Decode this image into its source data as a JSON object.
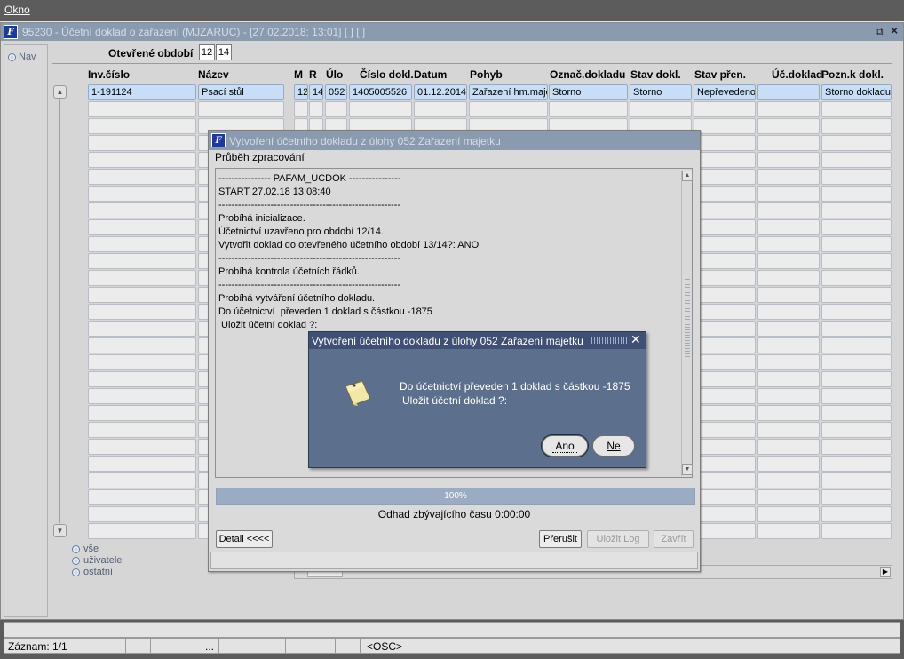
{
  "menu": {
    "okno": "Okno"
  },
  "window": {
    "title": "95230 - Účetní doklad o zařazení (MJZARUC) - [27.02.2018; 13:01]  [ ]  [ ]",
    "restore_icon": "restore-icon",
    "close_glyph": "×"
  },
  "nav": {
    "label": "Nav"
  },
  "period": {
    "label": "Otevřené období",
    "values": [
      "12",
      "14"
    ]
  },
  "table": {
    "headers": [
      "Inv.číslo",
      "Název",
      "M",
      "R",
      "Úlo",
      "Číslo dokl.",
      "Datum",
      "Pohyb",
      "Označ.dokladu",
      "Stav dokl.",
      "Stav přen.",
      "Úč.doklad",
      "Pozn.k dokl."
    ],
    "rows": [
      [
        "1-191124",
        "Psací stůl",
        "12",
        "14",
        "052",
        "1405005526",
        "01.12.2014",
        "Zařazení hm.maje",
        "Storno",
        "Storno",
        "Nepřevedeno",
        "",
        "Storno dokladu"
      ]
    ]
  },
  "filters": [
    "vše",
    "uživatele",
    "ostatní"
  ],
  "progress_dialog": {
    "title": "Vytvoření účetního dokladu z úlohy 052 Zařazení majetku",
    "section": "Průběh zpracování",
    "log": [
      "---------------- PAFAM_UCDOK ----------------",
      "START 27.02.18 13:08:40",
      "--------------------------------------------------------",
      "Probíhá inicializace.",
      "Účetnictví uzavřeno pro období 12/14.",
      "Vytvořit doklad do otevřeného účetního období 13/14?: ANO",
      "--------------------------------------------------------",
      "Probíhá kontrola účetních řádků.",
      "--------------------------------------------------------",
      "Probíhá vytváření účetního dokladu.",
      "Do účetnictví  převeden 1 doklad s částkou -1875",
      " Uložit účetní doklad ?:"
    ],
    "progress_value": 100,
    "progress_text": "100%",
    "eta": "Odhad zbývajícího času 0:00:00",
    "buttons": {
      "detail": "Detail <<<<",
      "prerusit": "Přerušit",
      "ulozit_log": "Uložit.Log",
      "zavrit": "Zavřít"
    }
  },
  "confirm_dialog": {
    "title": "Vytvoření účetního dokladu z úlohy 052 Zařazení majetku",
    "message_line1": "Do účetnictví  převeden 1 doklad s částkou -1875",
    "message_line2": "Uložit účetní doklad ?:",
    "icon": "note-icon",
    "yes": "Ano",
    "no": "Ne",
    "close_glyph": "✕"
  },
  "status": {
    "record": "Záznam: 1/1",
    "ellipsis": "...",
    "mode": "<OSC>"
  },
  "colors": {
    "title_bar": "#8a9bb0",
    "modal_bg": "#5c6f8d",
    "selected_row": "#c7def6"
  }
}
